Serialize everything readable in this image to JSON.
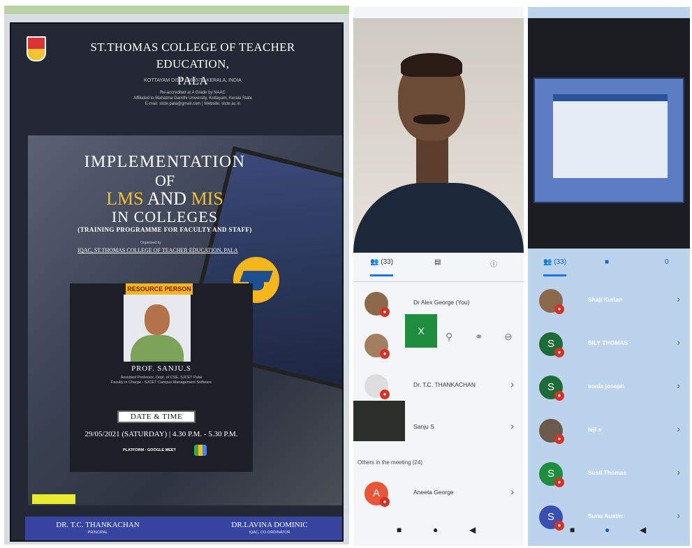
{
  "poster": {
    "college_name_line1": "ST.THOMAS COLLEGE OF TEACHER EDUCATION,",
    "college_name_line2": "PALA",
    "address": "KOTTAYAM DIST. - 686575, KERALA, INDIA",
    "accreditation_line1": "Re-accredited at A Grade by NAAC",
    "accreditation_line2": "Affiliated to Mahatma Gandhi University, Kottayam, Kerala State",
    "contact": "E-mail: stcte.pala@gmail.com  |  Website: stcte.ac.in",
    "title_line1": "IMPLEMENTATION",
    "title_line2": "OF",
    "title_line3_a": "LMS",
    "title_line3_b": "AND",
    "title_line3_c": "MIS",
    "title_line4": "IN COLLEGES",
    "subtitle": "(TRAINING PROGRAMME FOR FACULTY AND STAFF)",
    "organized_by": "Organized by",
    "organizer": "IQAC, ST.THOMAS COLLEGE OF TEACHER EDUCATION, PALA",
    "resource_person_label": "RESOURCE PERSON",
    "resource_person_name": "PROF. SANJU.S",
    "resource_person_desc1": "Assistant Professor, Dept. of CSE, SJCET Palai",
    "resource_person_desc2": "Faculty in Charge - SJCET Campus Management Software",
    "date_time_label": "DATE & TIME",
    "date_time_value": "29/05/2021 (SATURDAY) | 4.30 P.M. - 5.30 P.M.",
    "platform": "PLATFORM : GOOGLE MEET",
    "principal_name": "DR. T.C. THANKACHAN",
    "principal_role": "PRINCIPAL",
    "coordinator_name": "DR.LAVINA DOMINIC",
    "coordinator_role": "IQAC, CO-ORDINATOR"
  },
  "phone1": {
    "tabs": {
      "people": "(33)"
    },
    "participants": [
      {
        "name": "Dr Alex George (You)"
      },
      {
        "name": ""
      },
      {
        "name": "Dr. T.C. THANKACHAN"
      },
      {
        "name": "Sanju S"
      }
    ],
    "self_close": "X",
    "others_label": "Others in the meeting (24)",
    "others": [
      {
        "initial": "A",
        "name": "Aneeta George"
      }
    ]
  },
  "phone2": {
    "tabs": {
      "people": "(33)",
      "info": "0"
    },
    "participants": [
      {
        "initial": "",
        "name": "Shaji Kurian",
        "color": "#8a6a4a"
      },
      {
        "initial": "S",
        "name": "SILY THOMAS",
        "color": "#1e6b3a"
      },
      {
        "initial": "S",
        "name": "sonia joseph",
        "color": "#1e6b3a"
      },
      {
        "initial": "",
        "name": "teji s",
        "color": "#6a5a4a"
      },
      {
        "initial": "S",
        "name": "Susil Thomas",
        "color": "#1e8e3e"
      },
      {
        "initial": "S",
        "name": "Sunu Austin",
        "color": "#3a4fb0"
      }
    ]
  }
}
